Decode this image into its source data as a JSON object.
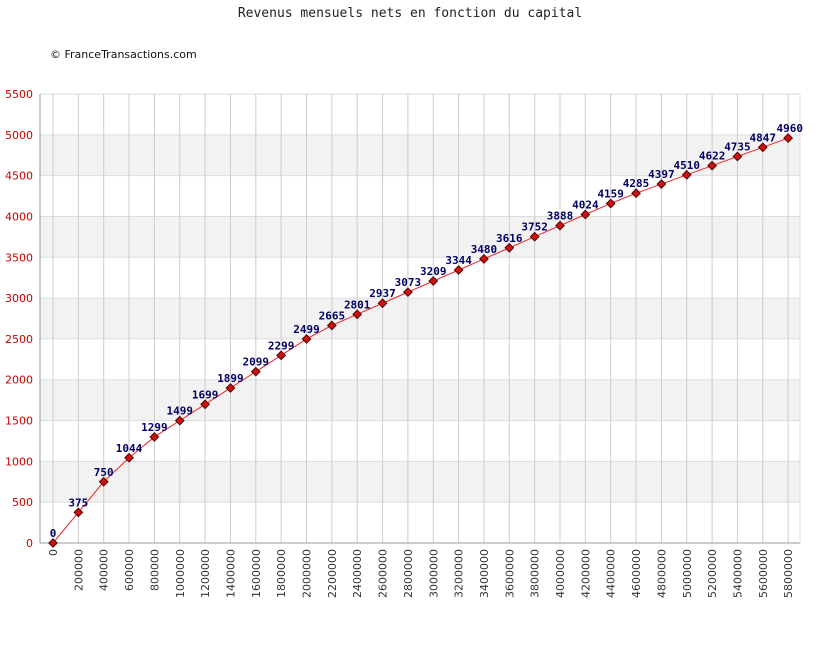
{
  "title": "Revenus mensuels nets en fonction du capital",
  "copyright": "© FranceTransactions.com",
  "colors": {
    "line": "#ee2222",
    "marker_fill": "#cc1111",
    "marker_stroke": "#550000",
    "band": "#f2f2f2",
    "grid": "#cccccc",
    "ytick": "#cc0000",
    "data_label": "#000066"
  },
  "chart_data": {
    "type": "line",
    "title": "Revenus mensuels nets en fonction du capital",
    "xlabel": "",
    "ylabel": "",
    "x": [
      0,
      200000,
      400000,
      600000,
      800000,
      1000000,
      1200000,
      1400000,
      1600000,
      1800000,
      2000000,
      2200000,
      2400000,
      2600000,
      2800000,
      3000000,
      3200000,
      3400000,
      3600000,
      3800000,
      4000000,
      4200000,
      4400000,
      4600000,
      4800000,
      5000000,
      5200000,
      5400000,
      5600000,
      5800000
    ],
    "values": [
      0,
      375,
      750,
      1044,
      1299,
      1499,
      1699,
      1899,
      2099,
      2299,
      2499,
      2665,
      2801,
      2937,
      3073,
      3209,
      3344,
      3480,
      3616,
      3752,
      3888,
      4024,
      4159,
      4285,
      4397,
      4510,
      4622,
      4735,
      4847,
      4960
    ],
    "ylim": [
      0,
      5500
    ],
    "yticks": [
      0,
      500,
      1000,
      1500,
      2000,
      2500,
      3000,
      3500,
      4000,
      4500,
      5000,
      5500
    ],
    "grid": true,
    "data_labels": true
  }
}
